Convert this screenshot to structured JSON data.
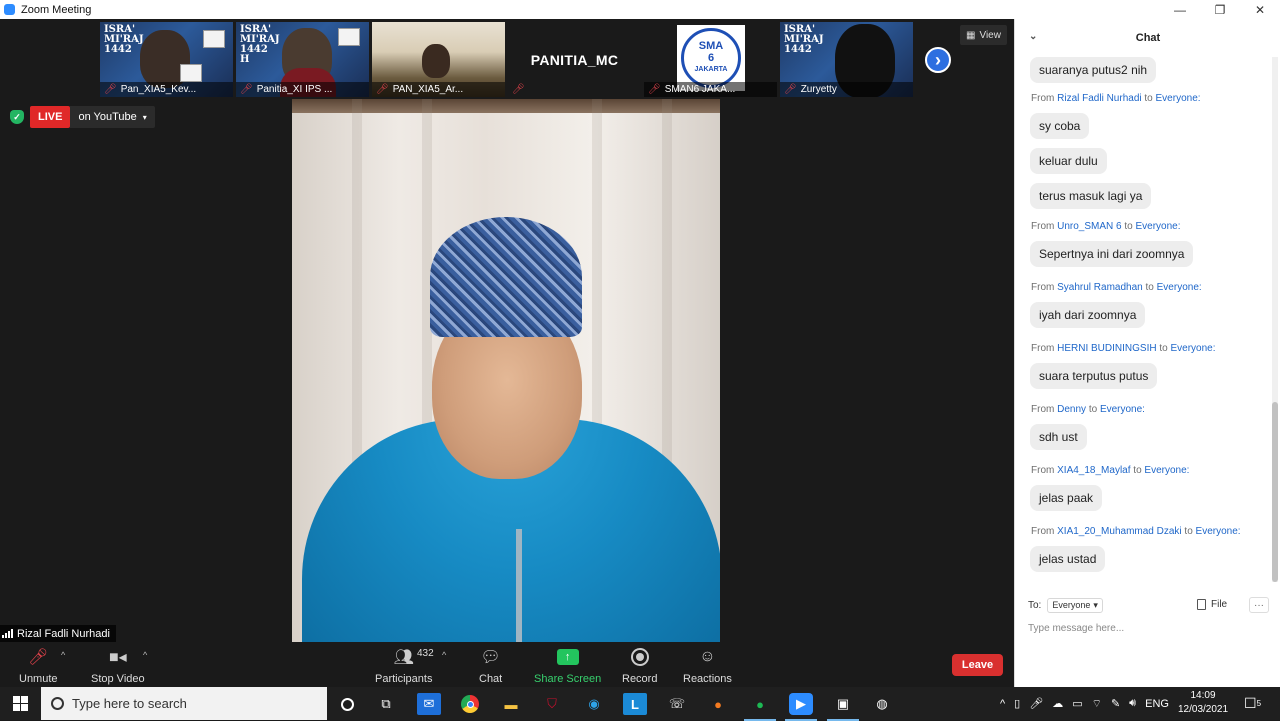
{
  "window": {
    "title": "Zoom Meeting",
    "controls": [
      "—",
      "❐",
      "✕"
    ]
  },
  "strip": {
    "participants": [
      {
        "name": "Pan_XIA5_Kev...",
        "poster": "ISRA' MI'RAJ 1442"
      },
      {
        "name": "Panitia_XI IPS ...",
        "poster": "ISRA' MI'RAJ 1442 H"
      },
      {
        "name": "PAN_XIA5_Ar..."
      },
      {
        "name": "PANITIA_MC"
      },
      {
        "name": "SMAN6 JAKA...",
        "logo": [
          "SMA",
          "6",
          "JAKARTA"
        ]
      },
      {
        "name": "Zuryetty",
        "poster": "ISRA' MI'RAJ 1442"
      }
    ],
    "view_label": "View"
  },
  "live": {
    "badge": "LIVE",
    "platform": "on YouTube"
  },
  "speaker": {
    "name": "Rizal Fadli Nurhadi"
  },
  "toolbar": {
    "unmute": "Unmute",
    "stop_video": "Stop Video",
    "participants": "Participants",
    "participant_count": "432",
    "chat": "Chat",
    "share_screen": "Share Screen",
    "record": "Record",
    "reactions": "Reactions",
    "leave": "Leave"
  },
  "chat": {
    "title": "Chat",
    "messages": [
      {
        "text": "suaranya putus2 nih"
      },
      {
        "from": "Rizal Fadli Nurhadi",
        "to": "Everyone:"
      },
      {
        "text": "sy coba"
      },
      {
        "text": "keluar dulu"
      },
      {
        "text": "terus masuk lagi ya"
      },
      {
        "from": "Unro_SMAN 6",
        "to": "Everyone:"
      },
      {
        "text": "Sepertnya ini dari zoomnya"
      },
      {
        "from": "Syahrul Ramadhan",
        "to": "Everyone:"
      },
      {
        "text": "iyah dari zoomnya"
      },
      {
        "from": "HERNI BUDININGSIH",
        "to": "Everyone:"
      },
      {
        "text": "suara terputus putus"
      },
      {
        "from": "Denny",
        "to": "Everyone:"
      },
      {
        "text": "sdh ust"
      },
      {
        "from": "XIA4_18_Maylaf",
        "to": "Everyone:"
      },
      {
        "text": "jelas paak"
      },
      {
        "from": "XIA1_20_Muhammad Dzaki",
        "to": "Everyone:"
      },
      {
        "text": "jelas ustad"
      }
    ],
    "from_word": "From",
    "to_word": "to",
    "to_label": "To:",
    "recipient": "Everyone",
    "file_label": "File",
    "more_label": "···",
    "input_placeholder": "Type message here..."
  },
  "taskbar": {
    "search_placeholder": "Type here to search",
    "language": "ENG",
    "time": "14:09",
    "date": "12/03/2021",
    "notifications": "5"
  }
}
